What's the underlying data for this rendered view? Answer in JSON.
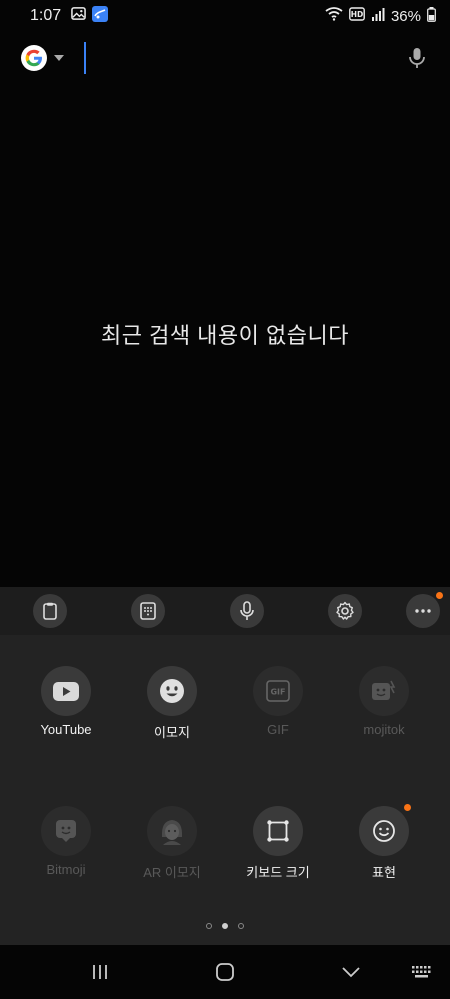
{
  "status_bar": {
    "time": "1:07",
    "battery": "36%",
    "icons": [
      "gallery-icon",
      "app-notification-icon",
      "wifi-icon",
      "hd-voice-icon",
      "signal-icon",
      "battery-icon"
    ]
  },
  "search": {
    "placeholder": "",
    "value": ""
  },
  "empty_message": "최근 검색 내용이 없습니다",
  "toolbar": {
    "buttons": [
      "clipboard-icon",
      "keypad-icon",
      "mic-icon",
      "settings-icon",
      "more-icon"
    ]
  },
  "panel": {
    "items": [
      {
        "label": "YouTube",
        "icon": "youtube-icon",
        "enabled": true
      },
      {
        "label": "이모지",
        "icon": "emoji-icon",
        "enabled": true
      },
      {
        "label": "GIF",
        "icon": "gif-icon",
        "enabled": false
      },
      {
        "label": "mojitok",
        "icon": "mojitok-icon",
        "enabled": false
      },
      {
        "label": "Bitmoji",
        "icon": "bitmoji-icon",
        "enabled": false
      },
      {
        "label": "AR 이모지",
        "icon": "ar-emoji-icon",
        "enabled": false
      },
      {
        "label": "키보드 크기",
        "icon": "keyboard-size-icon",
        "enabled": true
      },
      {
        "label": "표현",
        "icon": "expression-icon",
        "enabled": true
      }
    ],
    "page_count": 3,
    "active_page": 2
  },
  "colors": {
    "accent": "#3b82f6",
    "badge": "#f97316",
    "panel_bg": "#232323",
    "toolbar_bg": "#1d1d1d"
  }
}
